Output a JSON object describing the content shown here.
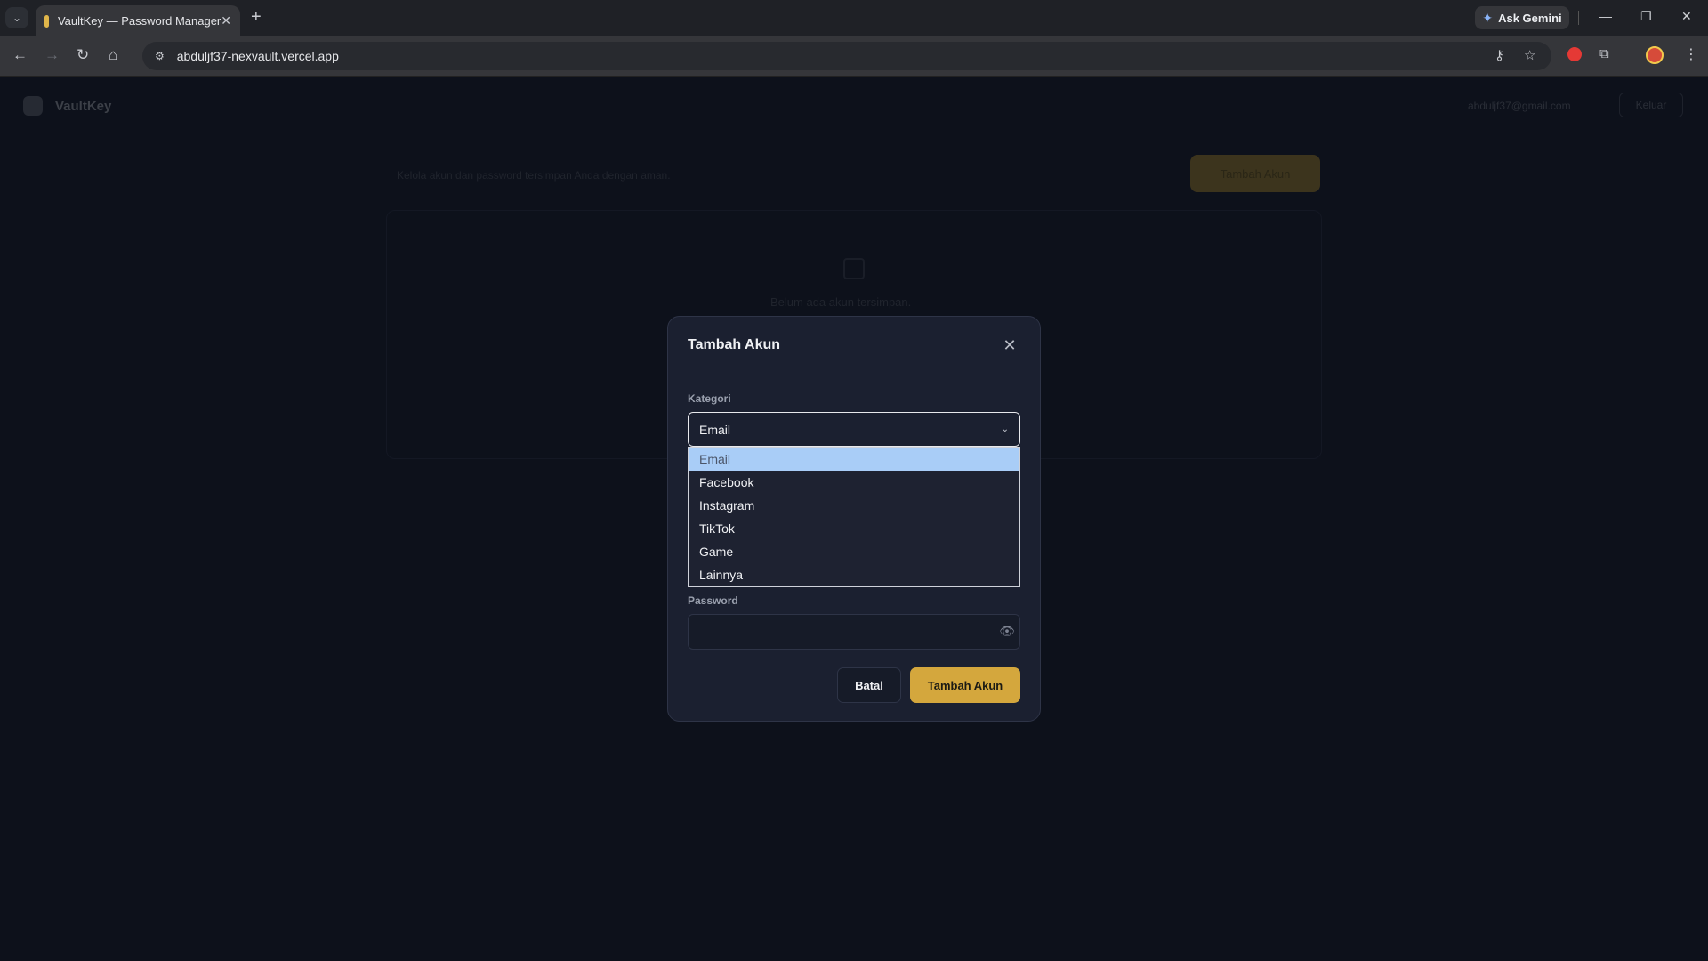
{
  "browser": {
    "tab_title": "VaultKey — Password Manager",
    "url": "abduljf37-nexvault.vercel.app",
    "gemini_label": "Ask Gemini"
  },
  "app": {
    "brand": "VaultKey",
    "user_email": "abduljf37@gmail.com",
    "logout_label": "Keluar",
    "info_text": "Kelola akun dan password tersimpan Anda dengan aman.",
    "add_button_label": "Tambah Akun",
    "empty_text": "Belum ada akun tersimpan."
  },
  "modal": {
    "title": "Tambah Akun",
    "category_label": "Kategori",
    "category_value": "Email",
    "category_options": [
      "Email",
      "Facebook",
      "Instagram",
      "TikTok",
      "Game",
      "Lainnya"
    ],
    "password_label": "Password",
    "password_value": "",
    "cancel_label": "Batal",
    "submit_label": "Tambah Akun"
  },
  "colors": {
    "accent": "#d4a73d",
    "modal_bg": "#1b2030",
    "page_bg": "#0d111b",
    "option_highlight": "#a9cdf7"
  }
}
